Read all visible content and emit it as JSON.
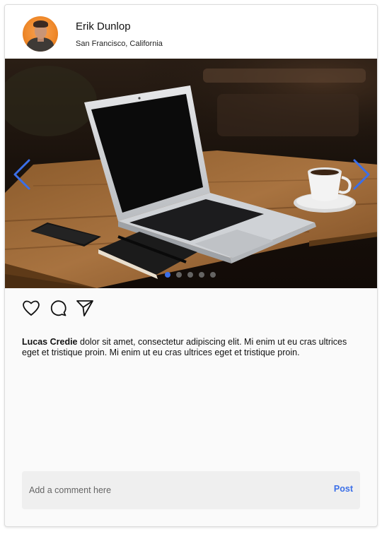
{
  "header": {
    "user_name": "Erik Dunlop",
    "location": "San Francisco, California"
  },
  "carousel": {
    "image_subject": "laptop on wooden table",
    "slide_count": 5,
    "active_slide": 1
  },
  "actions": {
    "icons": [
      "heart-icon",
      "comment-icon",
      "share-icon"
    ]
  },
  "caption": {
    "author": "Lucas Credie",
    "text": " dolor sit amet, consectetur adipiscing elit. Mi enim ut eu cras ultrices eget et tristique proin. Mi enim ut eu cras ultrices eget et tristique proin."
  },
  "comment": {
    "placeholder": "Add a comment here",
    "post_label": "Post"
  },
  "colors": {
    "accent": "#3b6fe8",
    "card_bg": "#fafafa",
    "comment_bg": "#efefef"
  }
}
